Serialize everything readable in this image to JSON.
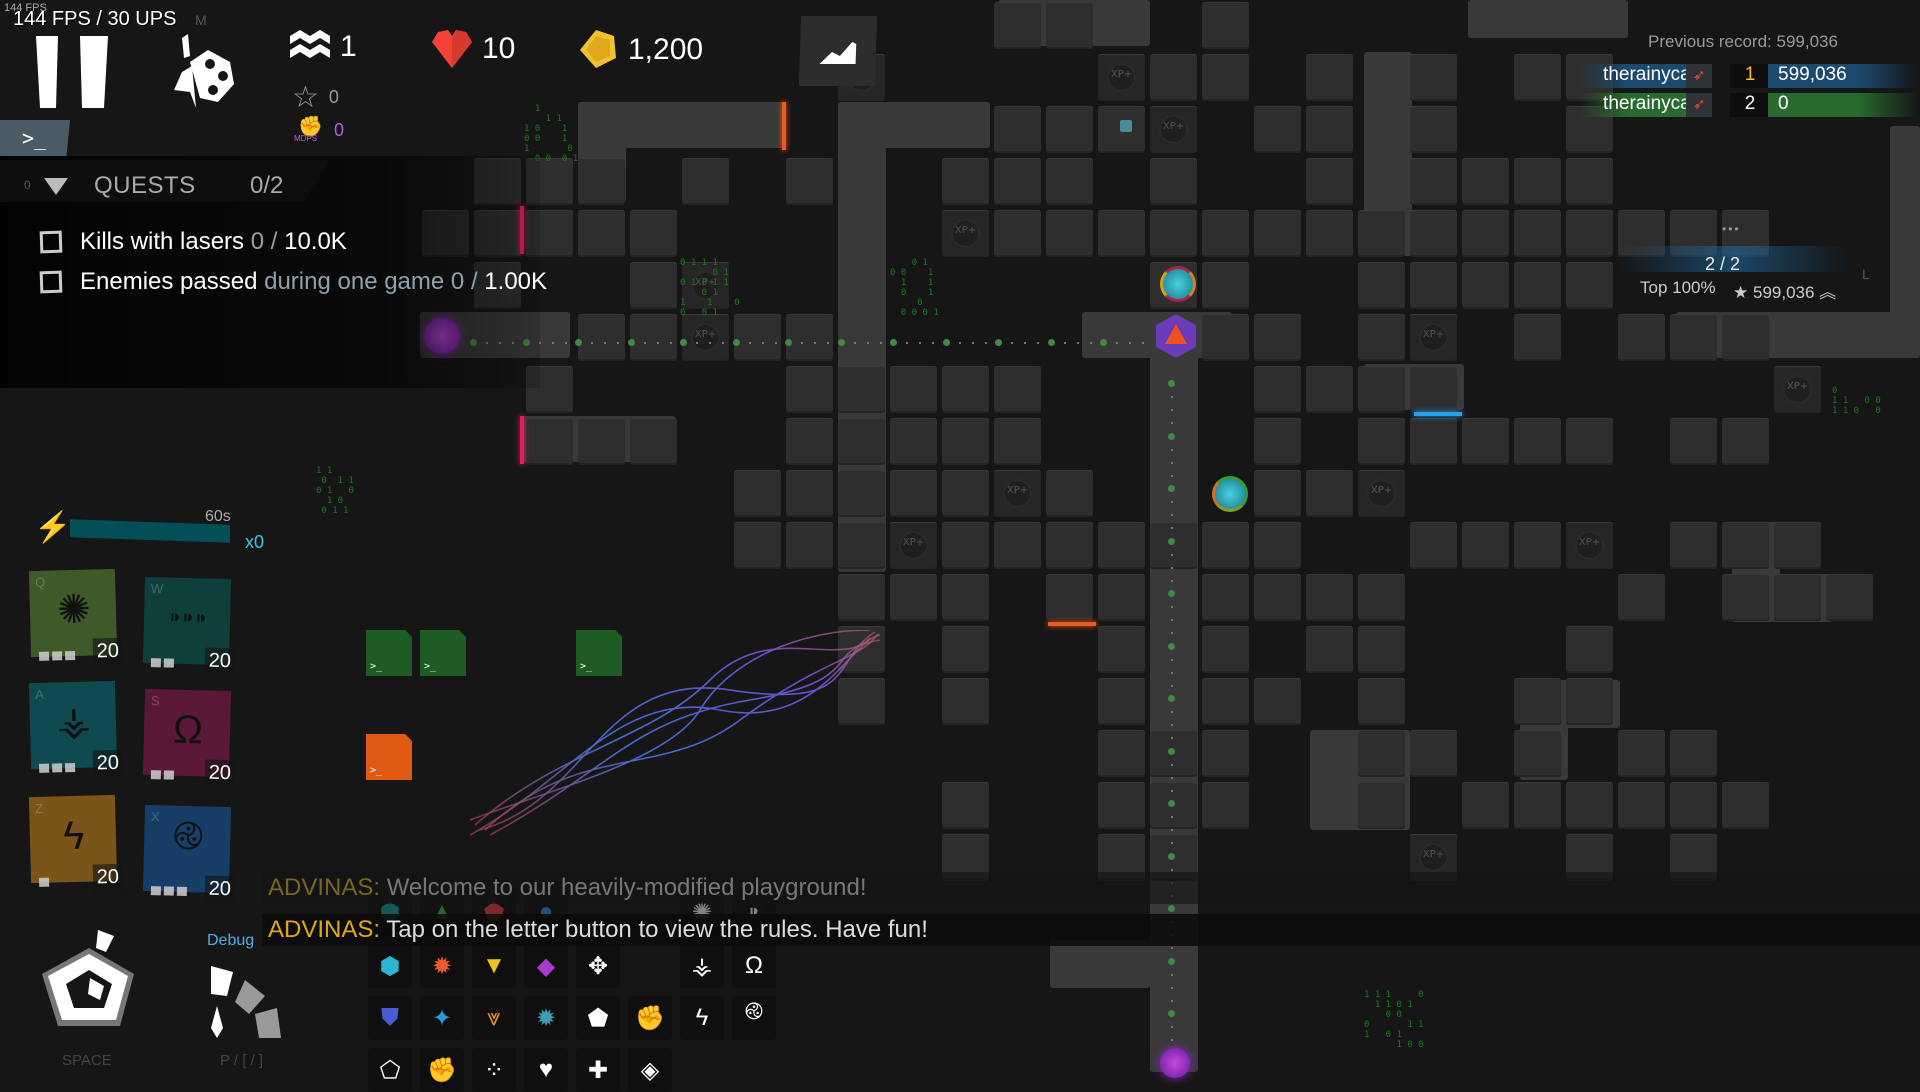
{
  "hud": {
    "fps_small": "144 FPS",
    "fps": "144 FPS / 30 UPS",
    "m_hotkey": "M",
    "wave": "1",
    "stars": "0",
    "mdps_label": "MDPS",
    "mdps": "0",
    "lives": "10",
    "coins": "1,200",
    "console_prompt": ">_"
  },
  "icons": {
    "pause": "pause-icon",
    "palette": "palette-icon",
    "wave": "wave-icon",
    "star": "star-icon",
    "mdps": "fist-icon",
    "heart": "heart-icon",
    "coin": "coin-icon",
    "graph": "graph-icon",
    "energy": "lightning-icon"
  },
  "quests": {
    "zero": "0",
    "title": "QUESTS",
    "count": "0/2",
    "items": [
      {
        "label": "Kills with lasers",
        "detail": "",
        "progress_value": "0",
        "progress_sep": " / ",
        "progress_target": "10.0K",
        "done": false
      },
      {
        "label": "Enemies passed",
        "detail": "during one game",
        "progress_value": "0",
        "progress_sep": " / ",
        "progress_target": "1.00K",
        "done": false
      }
    ]
  },
  "energy": {
    "time": "60s",
    "multiplier": "x0",
    "fill": 1.0
  },
  "abilities": [
    {
      "key": "Q",
      "icon": "firestorm-icon",
      "level": "20",
      "pips": 3,
      "color": "#3f5a28"
    },
    {
      "key": "W",
      "icon": "bullets-icon",
      "level": "20",
      "pips": 2,
      "color": "#0f3f3c"
    },
    {
      "key": "A",
      "icon": "blizzard-icon",
      "level": "20",
      "pips": 3,
      "color": "#0e4a50"
    },
    {
      "key": "S",
      "icon": "magnet-icon",
      "level": "20",
      "pips": 2,
      "color": "#5a1838"
    },
    {
      "key": "Z",
      "icon": "lightning-ball-icon",
      "level": "20",
      "pips": 1,
      "color": "#7a5418"
    },
    {
      "key": "X",
      "icon": "vortex-icon",
      "level": "20",
      "pips": 3,
      "color": "#173e66"
    }
  ],
  "controls": {
    "space_label": "SPACE",
    "debug_label": "Debug",
    "speed_label": "P / [ / ]"
  },
  "chat": [
    {
      "author": "ADVINAS:",
      "message": "Welcome to our heavily-modified playground!"
    },
    {
      "author": "ADVINAS:",
      "message": "Tap on the letter button to view the rules. Have fun!"
    }
  ],
  "build_menu": [
    [
      {
        "icon": "basic-tower-icon",
        "color": "#1a8f87"
      },
      {
        "icon": "sniper-tower-icon",
        "color": "#3fa24a"
      },
      {
        "icon": "cannon-tower-icon",
        "color": "#d03a3a"
      },
      {
        "icon": "freezing-tower-icon",
        "color": "#2a7fd4"
      },
      {
        "icon": "empty",
        "color": ""
      },
      {
        "icon": "empty",
        "color": ""
      },
      {
        "icon": "firestorm-ability-icon",
        "color": "#ddd"
      },
      {
        "icon": "bullet-wave-ability-icon",
        "color": "#ddd"
      }
    ],
    [
      {
        "icon": "venom-tower-icon",
        "color": "#2bb6d0"
      },
      {
        "icon": "splash-tower-icon",
        "color": "#f05a28"
      },
      {
        "icon": "blast-tower-icon",
        "color": "#f0c020"
      },
      {
        "icon": "multishot-tower-icon",
        "color": "#a83ad0"
      },
      {
        "icon": "mining-bonus-icon",
        "color": "#fff"
      },
      {
        "icon": "empty",
        "color": ""
      },
      {
        "icon": "blizzard-ability-icon",
        "color": "#fff"
      },
      {
        "icon": "magnet-ability-icon",
        "color": "#fff"
      }
    ],
    [
      {
        "icon": "minigun-tower-icon",
        "color": "#4a5bd0"
      },
      {
        "icon": "air-tower-icon",
        "color": "#2a9ae0"
      },
      {
        "icon": "tesla-tower-icon",
        "color": "#f09020"
      },
      {
        "icon": "missile-tower-icon",
        "color": "#3aa0b0"
      },
      {
        "icon": "core-bonus-icon",
        "color": "#fff"
      },
      {
        "icon": "power-bonus-icon",
        "color": "#fff"
      },
      {
        "icon": "ball-lightning-ability-icon",
        "color": "#fff"
      },
      {
        "icon": "loic-ability-icon",
        "color": "#fff"
      }
    ],
    [
      {
        "icon": "platform-icon",
        "color": "#fff"
      },
      {
        "icon": "fist-icon",
        "color": "#fff"
      },
      {
        "icon": "rocks-icon",
        "color": "#fff"
      },
      {
        "icon": "heart-shield-icon",
        "color": "#fff"
      },
      {
        "icon": "xp-bonus-icon",
        "color": "#fff"
      },
      {
        "icon": "energy-bonus-icon",
        "color": "#fff"
      }
    ]
  ],
  "leaderboard": {
    "previous_record": "Previous record: 599,036",
    "rows": [
      {
        "name": "therainycat",
        "rank": "1",
        "score": "599,036",
        "highlight": "blue"
      },
      {
        "name": "therainycat",
        "rank": "2",
        "score": "0",
        "highlight": "green"
      }
    ],
    "dots": "•••",
    "pager": "2 / 2",
    "top_percent": "Top 100%",
    "best_score": "599,036",
    "l_hotkey": "L"
  },
  "map": {
    "bonus_tile_label": "XP+"
  }
}
